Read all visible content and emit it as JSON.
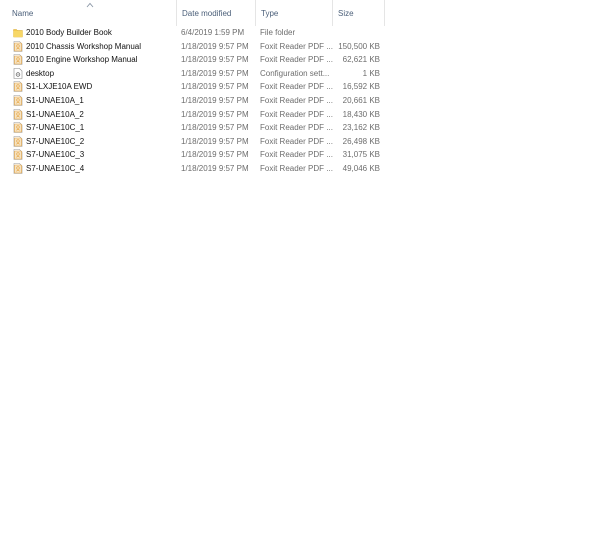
{
  "columns": {
    "name": "Name",
    "date_modified": "Date modified",
    "type": "Type",
    "size": "Size"
  },
  "sort": {
    "column": "name",
    "direction": "ascending",
    "icon": "sort-ascending-icon"
  },
  "files": [
    {
      "name": "2010 Body Builder Book",
      "date": "6/4/2019 1:59 PM",
      "type": "File folder",
      "size": "",
      "icon": "folder-icon"
    },
    {
      "name": "2010 Chassis Workshop Manual",
      "date": "1/18/2019 9:57 PM",
      "type": "Foxit Reader PDF ...",
      "size": "150,500 KB",
      "icon": "pdf-file-icon"
    },
    {
      "name": "2010 Engine Workshop Manual",
      "date": "1/18/2019 9:57 PM",
      "type": "Foxit Reader PDF ...",
      "size": "62,621 KB",
      "icon": "pdf-file-icon"
    },
    {
      "name": "desktop",
      "date": "1/18/2019 9:57 PM",
      "type": "Configuration sett...",
      "size": "1 KB",
      "icon": "settings-file-icon"
    },
    {
      "name": "S1-LXJE10A EWD",
      "date": "1/18/2019 9:57 PM",
      "type": "Foxit Reader PDF ...",
      "size": "16,592 KB",
      "icon": "pdf-file-icon"
    },
    {
      "name": "S1-UNAE10A_1",
      "date": "1/18/2019 9:57 PM",
      "type": "Foxit Reader PDF ...",
      "size": "20,661 KB",
      "icon": "pdf-file-icon"
    },
    {
      "name": "S1-UNAE10A_2",
      "date": "1/18/2019 9:57 PM",
      "type": "Foxit Reader PDF ...",
      "size": "18,430 KB",
      "icon": "pdf-file-icon"
    },
    {
      "name": "S7-UNAE10C_1",
      "date": "1/18/2019 9:57 PM",
      "type": "Foxit Reader PDF ...",
      "size": "23,162 KB",
      "icon": "pdf-file-icon"
    },
    {
      "name": "S7-UNAE10C_2",
      "date": "1/18/2019 9:57 PM",
      "type": "Foxit Reader PDF ...",
      "size": "26,498 KB",
      "icon": "pdf-file-icon"
    },
    {
      "name": "S7-UNAE10C_3",
      "date": "1/18/2019 9:57 PM",
      "type": "Foxit Reader PDF ...",
      "size": "31,075 KB",
      "icon": "pdf-file-icon"
    },
    {
      "name": "S7-UNAE10C_4",
      "date": "1/18/2019 9:57 PM",
      "type": "Foxit Reader PDF ...",
      "size": "49,046 KB",
      "icon": "pdf-file-icon"
    }
  ],
  "colors": {
    "header_text": "#4c607a",
    "folder": "#f2c94c",
    "pdf_accent": "#e6a23c"
  }
}
